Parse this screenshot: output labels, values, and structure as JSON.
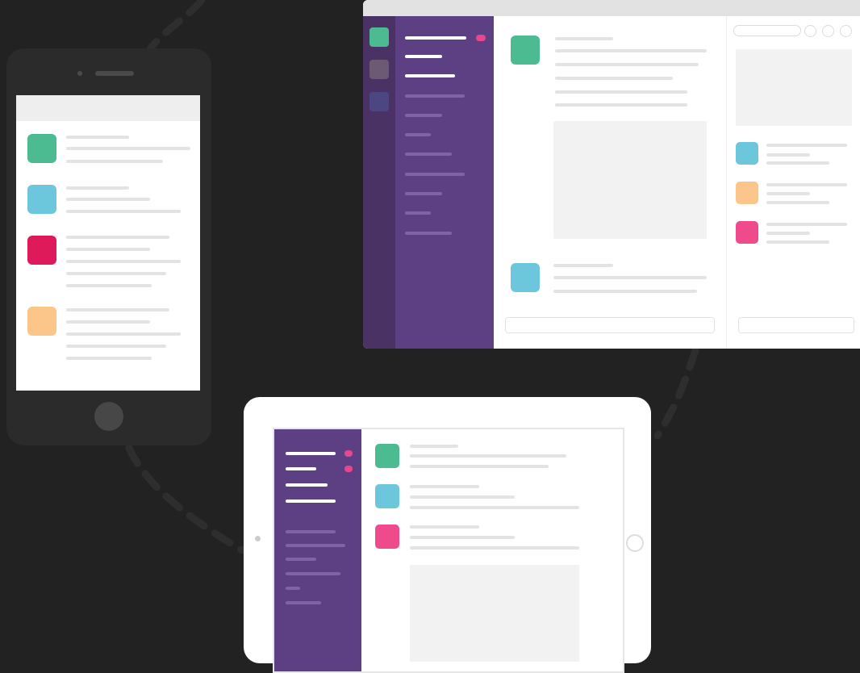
{
  "colors": {
    "background": "#222222",
    "device_dark": "#2b2b2b",
    "sidebar_purple": "#5c4083",
    "team_rail_purple": "#4a3364",
    "placeholder_line": "#e3e3e3",
    "placeholder_card": "#f2f2f2",
    "notification_pink": "#e8468f",
    "green": "#4cbb91",
    "light_blue": "#6cc7dd",
    "magenta": "#de1a5b",
    "peach": "#fcc589",
    "pink": "#ee4a8c",
    "rail_team_1": "#4cbb91",
    "rail_team_2": "#6b5a72",
    "rail_team_3": "#4c4683"
  },
  "devices": [
    "phone",
    "desktop",
    "tablet"
  ],
  "phone": {
    "messages": [
      {
        "avatar_color": "#4cbb91",
        "lines": 3
      },
      {
        "avatar_color": "#6cc7dd",
        "lines": 3
      },
      {
        "avatar_color": "#de1a5b",
        "lines": 5
      },
      {
        "avatar_color": "#fcc589",
        "lines": 5
      }
    ]
  },
  "desktop": {
    "team_icons": [
      "#4cbb91",
      "#6b5a72",
      "#4c4683"
    ],
    "channels_bold": 3,
    "channels_regular": 8,
    "messages": [
      {
        "avatar_color": "#4cbb91",
        "lines": 6,
        "has_attachment": true
      },
      {
        "avatar_color": "#6cc7dd",
        "lines": 3,
        "has_attachment": false
      }
    ],
    "side_panel_items": [
      {
        "avatar_color": "#6cc7dd"
      },
      {
        "avatar_color": "#fcc589"
      },
      {
        "avatar_color": "#ee4a8c"
      }
    ]
  },
  "tablet": {
    "channels_bold": 4,
    "channels_regular": 6,
    "messages": [
      {
        "avatar_color": "#4cbb91"
      },
      {
        "avatar_color": "#6cc7dd"
      },
      {
        "avatar_color": "#ee4a8c"
      }
    ]
  }
}
